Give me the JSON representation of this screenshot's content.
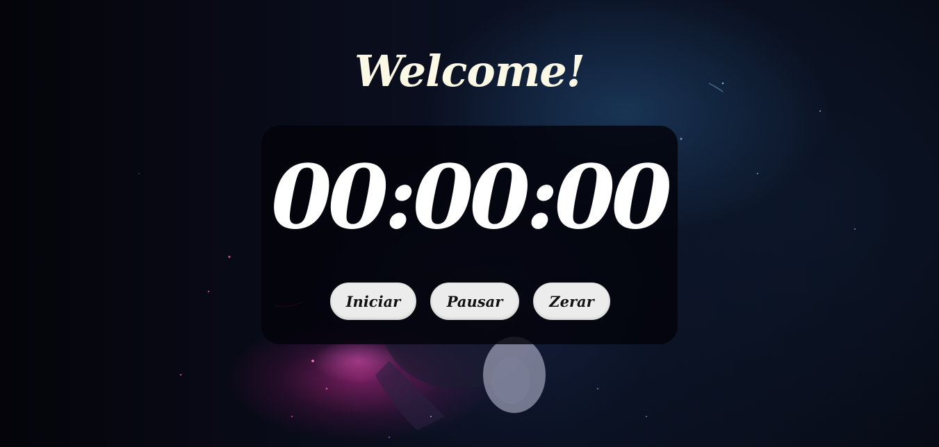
{
  "header": {
    "title": "Welcome!"
  },
  "stopwatch": {
    "time": "00:00:00"
  },
  "controls": {
    "start_label": "Iniciar",
    "pause_label": "Pausar",
    "reset_label": "Zerar"
  },
  "theme": {
    "title_color": "#fbf8e6",
    "timer_color": "#ffffff",
    "button_bg": "#ececec",
    "panel_bg": "#03030a",
    "page_bg": "#090b18"
  },
  "background": {
    "image": "astronaut-nebula-space"
  }
}
